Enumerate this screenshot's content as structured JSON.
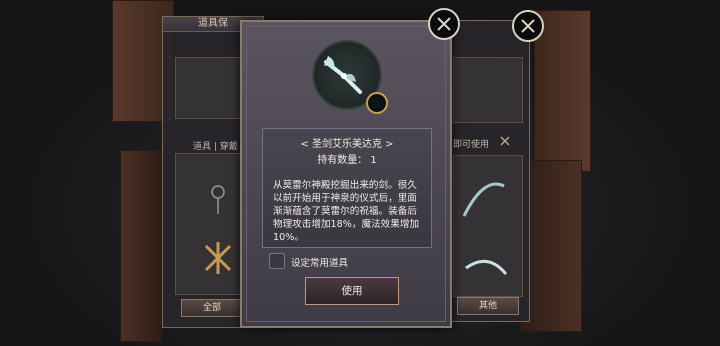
{
  "back_left": {
    "title": "道具保",
    "tab_label": "道具 | 穿戴",
    "category_all": "全部"
  },
  "back_right": {
    "hint_label": "即可使用",
    "category_other": "其他"
  },
  "dialog": {
    "item_name": "< 圣剑艾乐美达克 >",
    "item_count": "持有数量： 1",
    "item_description": "从莫雷尔神殿挖掘出来的剑。很久以前开始用于神泉的仪式后，里面渐渐蕴含了莫雷尔的祝福。装备后物理攻击增加18%，魔法效果增加10%。",
    "checkbox_label": "设定常用道具",
    "use_button": "使用"
  },
  "colors": {
    "accent_border": "#8a7c6a",
    "dialog_bg": "#4a4650",
    "text": "#f0ece6"
  },
  "icons": {
    "close": "close-x-icon",
    "item": "sword-icon"
  }
}
